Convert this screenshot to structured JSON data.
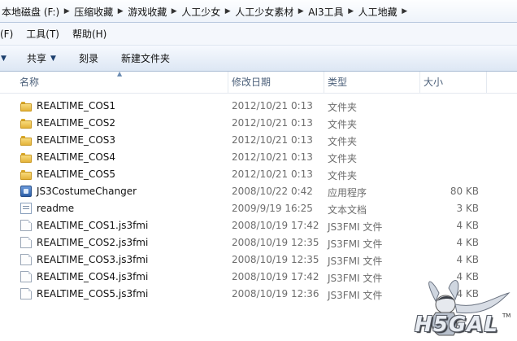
{
  "breadcrumbs": [
    "本地磁盘 (F:)",
    "压缩收藏",
    "游戏收藏",
    "人工少女",
    "人工少女素材",
    "AI3工具",
    "人工地藏"
  ],
  "menu": [
    "(F)",
    "工具(T)",
    "帮助(H)"
  ],
  "toolbar": {
    "share_label": "共享",
    "burn_label": "刻录",
    "new_folder_label": "新建文件夹"
  },
  "columns": {
    "name": "名称",
    "date": "修改日期",
    "type": "类型",
    "size": "大小"
  },
  "files": [
    {
      "name": "REALTIME_COS1",
      "date": "2012/10/21 0:13",
      "type": "文件夹",
      "size": "",
      "icon": "folder"
    },
    {
      "name": "REALTIME_COS2",
      "date": "2012/10/21 0:13",
      "type": "文件夹",
      "size": "",
      "icon": "folder"
    },
    {
      "name": "REALTIME_COS3",
      "date": "2012/10/21 0:13",
      "type": "文件夹",
      "size": "",
      "icon": "folder"
    },
    {
      "name": "REALTIME_COS4",
      "date": "2012/10/21 0:13",
      "type": "文件夹",
      "size": "",
      "icon": "folder"
    },
    {
      "name": "REALTIME_COS5",
      "date": "2012/10/21 0:13",
      "type": "文件夹",
      "size": "",
      "icon": "folder"
    },
    {
      "name": "JS3CostumeChanger",
      "date": "2008/10/22 0:42",
      "type": "应用程序",
      "size": "80 KB",
      "icon": "application"
    },
    {
      "name": "readme",
      "date": "2009/9/19 16:25",
      "type": "文本文档",
      "size": "3 KB",
      "icon": "text-document"
    },
    {
      "name": "REALTIME_COS1.js3fmi",
      "date": "2008/10/19 17:42",
      "type": "JS3FMI 文件",
      "size": "4 KB",
      "icon": "file"
    },
    {
      "name": "REALTIME_COS2.js3fmi",
      "date": "2008/10/19 12:35",
      "type": "JS3FMI 文件",
      "size": "4 KB",
      "icon": "file"
    },
    {
      "name": "REALTIME_COS3.js3fmi",
      "date": "2008/10/19 12:35",
      "type": "JS3FMI 文件",
      "size": "4 KB",
      "icon": "file"
    },
    {
      "name": "REALTIME_COS4.js3fmi",
      "date": "2008/10/19 17:42",
      "type": "JS3FMI 文件",
      "size": "4 KB",
      "icon": "file"
    },
    {
      "name": "REALTIME_COS5.js3fmi",
      "date": "2008/10/19 12:36",
      "type": "JS3FMI 文件",
      "size": "4 KB",
      "icon": "file"
    }
  ],
  "watermark": {
    "text": "H5GAL",
    "tm": "TM"
  },
  "icons": {
    "folder": "folder-icon",
    "application": "application-icon",
    "text-document": "text-document-icon",
    "file": "file-icon"
  },
  "colors": {
    "toolbar_bg": "#dde7f4",
    "header_text": "#4c607a",
    "detail_text": "#6d6d6d"
  }
}
